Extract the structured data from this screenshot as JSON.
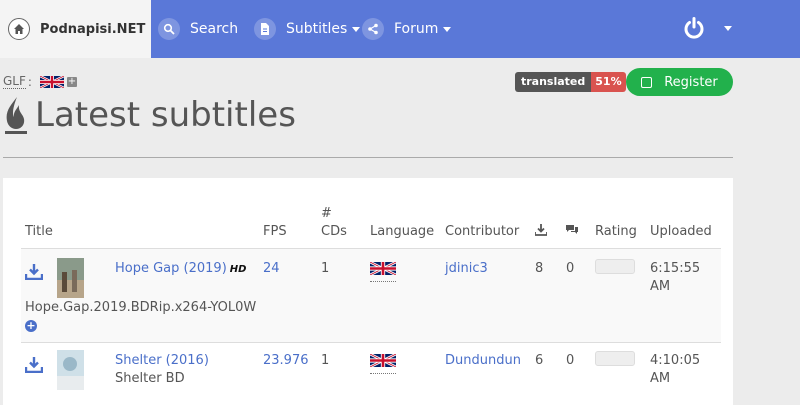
{
  "navbar": {
    "brand": "Podnapisi.NET",
    "items": [
      {
        "label": "Search",
        "icon": "search-icon"
      },
      {
        "label": "Subtitles",
        "icon": "document-icon"
      },
      {
        "label": "Forum",
        "icon": "share-icon"
      }
    ],
    "power_icon": "power-icon"
  },
  "subheader": {
    "glf_label": "GLF",
    "glf_sep": ":",
    "translated_label": "translated",
    "translated_percent": "51%",
    "register_label": "Register"
  },
  "page": {
    "title": "Latest subtitles"
  },
  "table": {
    "headers": {
      "title": "Title",
      "fps": "FPS",
      "cds_hash": "#",
      "cds": "CDs",
      "language": "Language",
      "contributor": "Contributor",
      "rating": "Rating",
      "uploaded": "Uploaded"
    },
    "rows": [
      {
        "title": "Hope Gap (2019)",
        "hd": "HD",
        "release": "Hope.Gap.2019.BDRip.x264-YOL0W",
        "fps": "24",
        "cds": "1",
        "contributor": "jdinic3",
        "downloads": "8",
        "comments": "0",
        "uploaded_time": "6:15:55",
        "uploaded_ampm": "AM"
      },
      {
        "title": "Shelter (2016)",
        "release": "Shelter BD",
        "fps": "23.976",
        "cds": "1",
        "contributor": "Dundundun",
        "downloads": "6",
        "comments": "0",
        "uploaded_time": "4:10:05",
        "uploaded_ampm": "AM"
      }
    ]
  },
  "colors": {
    "navbar": "#5a78d8",
    "register": "#22b14c",
    "translated_pct": "#d9534f",
    "link": "#4a6fc9"
  }
}
